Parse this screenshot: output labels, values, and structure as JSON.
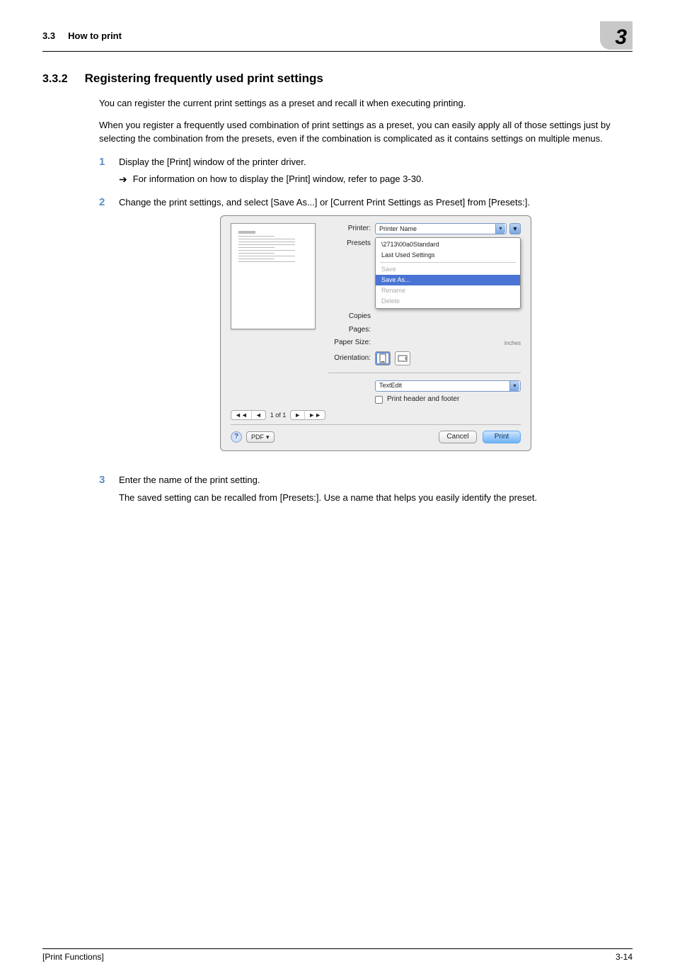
{
  "header": {
    "section_ref": "3.3",
    "section_ref_title": "How to print",
    "chapter_num": "3"
  },
  "section": {
    "number": "3.3.2",
    "title": "Registering frequently used print settings"
  },
  "intro": {
    "p1": "You can register the current print settings as a preset and recall it when executing printing.",
    "p2": "When you register a frequently used combination of print settings as a preset, you can easily apply all of those settings just by selecting the combination from the presets, even if the combination is complicated as it contains settings on multiple menus."
  },
  "steps": {
    "s1": {
      "num": "1",
      "text": "Display the [Print] window of the printer driver.",
      "sub": "For information on how to display the [Print] window, refer to page 3-30."
    },
    "s2": {
      "num": "2",
      "text": "Change the print settings, and select [Save As...] or [Current Print Settings as Preset] from [Presets:]."
    },
    "s3": {
      "num": "3",
      "text": "Enter the name of the print setting.",
      "p2": "The saved setting can be recalled from [Presets:]. Use a name that helps you easily identify the preset."
    }
  },
  "dlg": {
    "printer_label": "Printer:",
    "printer_value": "Printer Name",
    "presets_label": "Presets",
    "presets_menu": {
      "standard": "Standard",
      "last_used": "Last Used Settings",
      "save": "Save",
      "save_as": "Save As...",
      "rename": "Rename",
      "delete": "Delete"
    },
    "copies_label": "Copies",
    "pages_label": "Pages:",
    "paper_size_label": "Paper Size:",
    "inches": "inches",
    "orientation_label": "Orientation:",
    "panel_select": "TextEdit",
    "print_hf": "Print header and footer",
    "pager": "1 of 1",
    "pdf": "PDF",
    "cancel": "Cancel",
    "print": "Print"
  },
  "footer": {
    "left": "[Print Functions]",
    "right": "3-14"
  }
}
